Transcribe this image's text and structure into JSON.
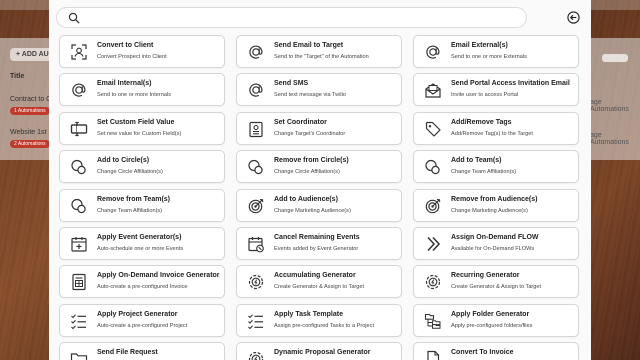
{
  "background_app": {
    "add_label": "+ ADD AU",
    "title_header": "Title",
    "row1_text": "Contract to C",
    "row1_badge": "1 Automations",
    "row2_text": "Website 1st Fo",
    "row2_badge": "2 Automations",
    "right_label_1": "age Automations",
    "right_label_2": "age Automations"
  },
  "search": {
    "placeholder": "",
    "value": ""
  },
  "actions": [
    {
      "title": "Convert to Client",
      "subtitle": "Convert Prospect into Client",
      "icon": "convert-client-icon"
    },
    {
      "title": "Send Email to Target",
      "subtitle": "Send to the \"Target\" of the Automation",
      "icon": "at-sign-icon"
    },
    {
      "title": "Email External(s)",
      "subtitle": "Send to one or more Externals",
      "icon": "at-sign-icon"
    },
    {
      "title": "Email Internal(s)",
      "subtitle": "Send to one or more Internals",
      "icon": "at-sign-icon"
    },
    {
      "title": "Send SMS",
      "subtitle": "Send text message via Twilio",
      "icon": "at-sign-icon"
    },
    {
      "title": "Send Portal Access Invitation Email",
      "subtitle": "Invite user to access Portal",
      "icon": "envelope-open-icon"
    },
    {
      "title": "Set Custom Field Value",
      "subtitle": "Set new value for Custom Field(s)",
      "icon": "text-cursor-icon"
    },
    {
      "title": "Set Coordinator",
      "subtitle": "Change Target's Coordinator",
      "icon": "id-badge-icon"
    },
    {
      "title": "Add/Remove Tags",
      "subtitle": "Add/Remove Tag(s) to the Target",
      "icon": "tag-icon"
    },
    {
      "title": "Add to Circle(s)",
      "subtitle": "Change Circle Affiliation(s)",
      "icon": "circles-icon"
    },
    {
      "title": "Remove from Circle(s)",
      "subtitle": "Change Circle Affiliation(s)",
      "icon": "circles-icon"
    },
    {
      "title": "Add to Team(s)",
      "subtitle": "Change Team Affiliation(s)",
      "icon": "circles-icon"
    },
    {
      "title": "Remove from Team(s)",
      "subtitle": "Change Team Affiliation(s)",
      "icon": "circles-icon"
    },
    {
      "title": "Add to Audience(s)",
      "subtitle": "Change Marketing Audience(s)",
      "icon": "target-icon"
    },
    {
      "title": "Remove from Audience(s)",
      "subtitle": "Change Marketing Audience(s)",
      "icon": "target-icon"
    },
    {
      "title": "Apply Event Generator(s)",
      "subtitle": "Auto-schedule one or more Events",
      "icon": "calendar-plus-icon"
    },
    {
      "title": "Cancel Remaining Events",
      "subtitle": "Events added by Event Generator",
      "icon": "calendar-cancel-icon"
    },
    {
      "title": "Assign On-Demand FLOW",
      "subtitle": "Available for On-Demand FLOWs",
      "icon": "double-chevron-icon"
    },
    {
      "title": "Apply On-Demand Invoice Generator",
      "subtitle": "Auto-create a pre-configured Invoice",
      "icon": "invoice-icon"
    },
    {
      "title": "Accumulating Generator",
      "subtitle": "Create Generator & Assign to Target",
      "icon": "gear-badge-icon"
    },
    {
      "title": "Recurring Generator",
      "subtitle": "Create Generator & Assign to Target",
      "icon": "gear-badge-icon"
    },
    {
      "title": "Apply Project Generator",
      "subtitle": "Auto-create a pre-configured Project",
      "icon": "checklist-icon"
    },
    {
      "title": "Apply Task Template",
      "subtitle": "Assign pre-configured Tasks to a Project",
      "icon": "checklist-icon"
    },
    {
      "title": "Apply Folder Generator",
      "subtitle": "Apply pre-configured folders/files",
      "icon": "folder-tree-icon"
    },
    {
      "title": "Send File Request",
      "subtitle": "",
      "icon": "folder-icon"
    },
    {
      "title": "Dynamic Proposal Generator",
      "subtitle": "",
      "icon": "gear-badge-icon"
    },
    {
      "title": "Convert To Invoice",
      "subtitle": "",
      "icon": "document-icon"
    }
  ]
}
